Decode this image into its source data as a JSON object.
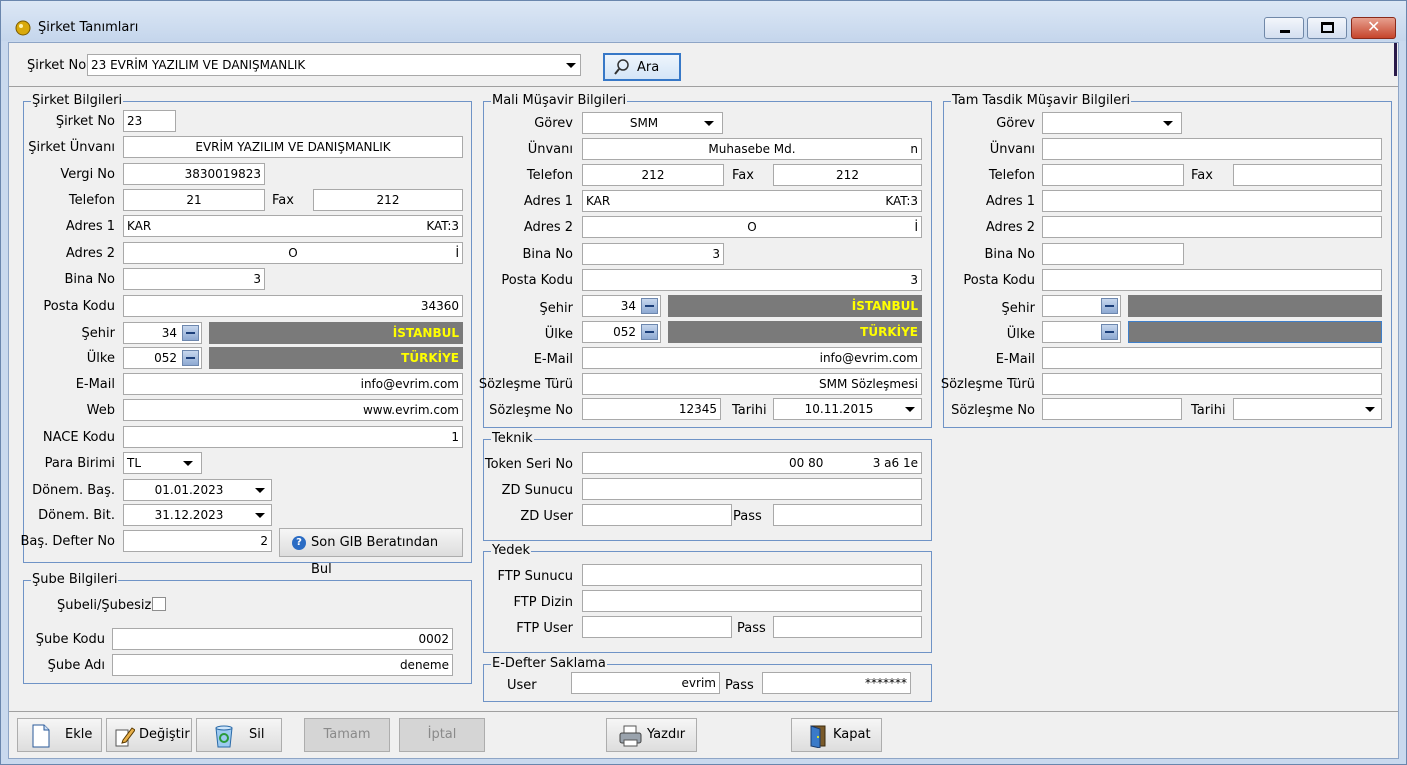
{
  "window": {
    "title": "Şirket Tanımları"
  },
  "top": {
    "label": "Şirket No",
    "value": "23 EVRİM YAZILIM VE DANIŞMANLIK",
    "ara": "Ara"
  },
  "sirket": {
    "title": "Şirket Bilgileri",
    "no_l": "Şirket No",
    "no": "23",
    "unvan_l": "Şirket Ünvanı",
    "unvan": "EVRİM YAZILIM VE DANIŞMANLIK",
    "vergi_l": "Vergi No",
    "vergi": "3830019823",
    "tel_l": "Telefon",
    "tel": "21",
    "fax_l": "Fax",
    "fax": "212",
    "adr1_l": "Adres 1",
    "adr1a": "KAR",
    "adr1b": "KAT:3",
    "adr2_l": "Adres 2",
    "adr2a": "O",
    "adr2b": "İ",
    "bina_l": "Bina No",
    "bina": "3",
    "posta_l": "Posta Kodu",
    "posta": "34360",
    "sehir_l": "Şehir",
    "sehir_no": "34",
    "sehir": "İSTANBUL",
    "ulke_l": "Ülke",
    "ulke_no": "052",
    "ulke": "TÜRKİYE",
    "mail_l": "E-Mail",
    "mail": "info@evrim.com",
    "web_l": "Web",
    "web": "www.evrim.com",
    "nace_l": "NACE Kodu",
    "nace": "1",
    "para_l": "Para Birimi",
    "para": "TL",
    "db_l": "Dönem. Baş.",
    "db": "01.01.2023",
    "dbt_l": "Dönem. Bit.",
    "dbt": "31.12.2023",
    "bd_l": "Baş. Defter No",
    "bd": "2",
    "gib": "Son GIB Beratından Bul"
  },
  "sube": {
    "title": "Şube Bilgileri",
    "check_l": "Şubeli/Şubesiz",
    "kod_l": "Şube Kodu",
    "kod": "0002",
    "ad_l": "Şube Adı",
    "ad": "deneme"
  },
  "mali": {
    "title": "Mali Müşavir Bilgileri",
    "gorev_l": "Görev",
    "gorev": "SMM",
    "unvan_l": "Ünvanı",
    "unvan": "Muhasebe Md.",
    "unvan_b": "n",
    "tel_l": "Telefon",
    "tel": "212",
    "fax_l": "Fax",
    "fax": "212",
    "adr1_l": "Adres 1",
    "adr1a": "KAR",
    "adr1b": "KAT:3",
    "adr2_l": "Adres 2",
    "adr2a": "O",
    "adr2b": "İ",
    "bina_l": "Bina No",
    "bina": "3",
    "posta_l": "Posta Kodu",
    "posta": "3",
    "sehir_l": "Şehir",
    "sehir_no": "34",
    "sehir": "İSTANBUL",
    "ulke_l": "Ülke",
    "ulke_no": "052",
    "ulke": "TÜRKİYE",
    "mail_l": "E-Mail",
    "mail": "info@evrim.com",
    "st_l": "Sözleşme Türü",
    "st": "SMM Sözleşmesi",
    "sn_l": "Sözleşme No",
    "sn": "12345",
    "tarih_l": "Tarihi",
    "tarih": "10.11.2015"
  },
  "teknik": {
    "title": "Teknik",
    "token_l": "Token Seri No",
    "token_a": "00 80",
    "token_b": "3 a6 1e",
    "zd_l": "ZD Sunucu",
    "zdu_l": "ZD User",
    "pass_l": "Pass"
  },
  "yedek": {
    "title": "Yedek",
    "ftp_l": "FTP Sunucu",
    "dizin_l": "FTP Dizin",
    "user_l": "FTP User",
    "pass_l": "Pass"
  },
  "edefter": {
    "title": "E-Defter Saklama",
    "user_l": "User",
    "user": "evrim",
    "pass_l": "Pass",
    "pass": "*******"
  },
  "tam": {
    "title": "Tam Tasdik Müşavir Bilgileri",
    "gorev_l": "Görev",
    "unvan_l": "Ünvanı",
    "tel_l": "Telefon",
    "fax_l": "Fax",
    "adr1_l": "Adres 1",
    "adr2_l": "Adres 2",
    "bina_l": "Bina No",
    "posta_l": "Posta Kodu",
    "sehir_l": "Şehir",
    "ulke_l": "Ülke",
    "mail_l": "E-Mail",
    "st_l": "Sözleşme Türü",
    "sn_l": "Sözleşme No",
    "tarih_l": "Tarihi"
  },
  "buttons": {
    "ekle": "Ekle",
    "degistir": "Değiştir",
    "sil": "Sil",
    "tamam": "Tamam",
    "iptal": "İptal",
    "yazdir": "Yazdır",
    "kapat": "Kapat"
  }
}
